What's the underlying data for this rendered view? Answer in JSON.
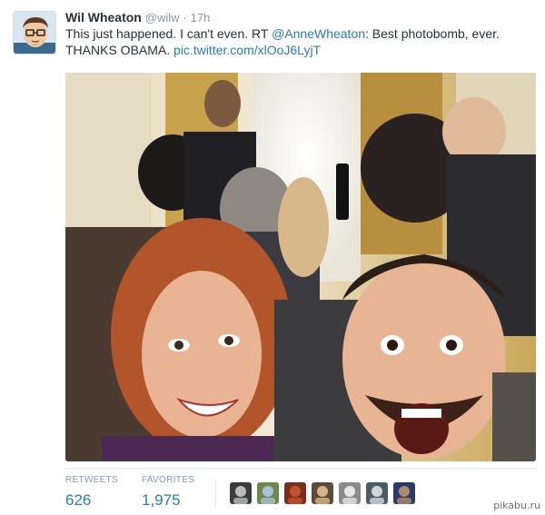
{
  "tweet": {
    "author_name": "Wil Wheaton",
    "author_handle": "@wilw",
    "separator": "·",
    "time": "17h",
    "text": {
      "line1_part1": "This just happened. I can't even. RT ",
      "mention": "@AnneWheaton",
      "line1_part2": ": Best photobomb, ever.",
      "line2_part1": "THANKS OBAMA. ",
      "pic_link": "pic.twitter.com/xlOoJ6LyjT"
    }
  },
  "stats": {
    "retweets_label": "RETWEETS",
    "retweets_value": "626",
    "favorites_label": "FAVORITES",
    "favorites_value": "1,975"
  },
  "favoriters": [
    {
      "name": "favoriter-avatar-1",
      "color": "#3b3b3b",
      "accent": "#bdbdbd"
    },
    {
      "name": "favoriter-avatar-2",
      "color": "#6e8a4a",
      "accent": "#a9c2d8"
    },
    {
      "name": "favoriter-avatar-3",
      "color": "#7a2f1e",
      "accent": "#c4532e"
    },
    {
      "name": "favoriter-avatar-4",
      "color": "#5a4b3a",
      "accent": "#d9b48a"
    },
    {
      "name": "favoriter-avatar-5",
      "color": "#8a8a8a",
      "accent": "#e6e6e6"
    },
    {
      "name": "favoriter-avatar-6",
      "color": "#4d5b66",
      "accent": "#cfd8de"
    },
    {
      "name": "favoriter-avatar-7",
      "color": "#2a3a6a",
      "accent": "#b08a6a"
    }
  ],
  "watermark": "pikabu.ru",
  "colors": {
    "link": "#2b7bb9",
    "muted": "#8899a6",
    "text": "#292f33"
  }
}
